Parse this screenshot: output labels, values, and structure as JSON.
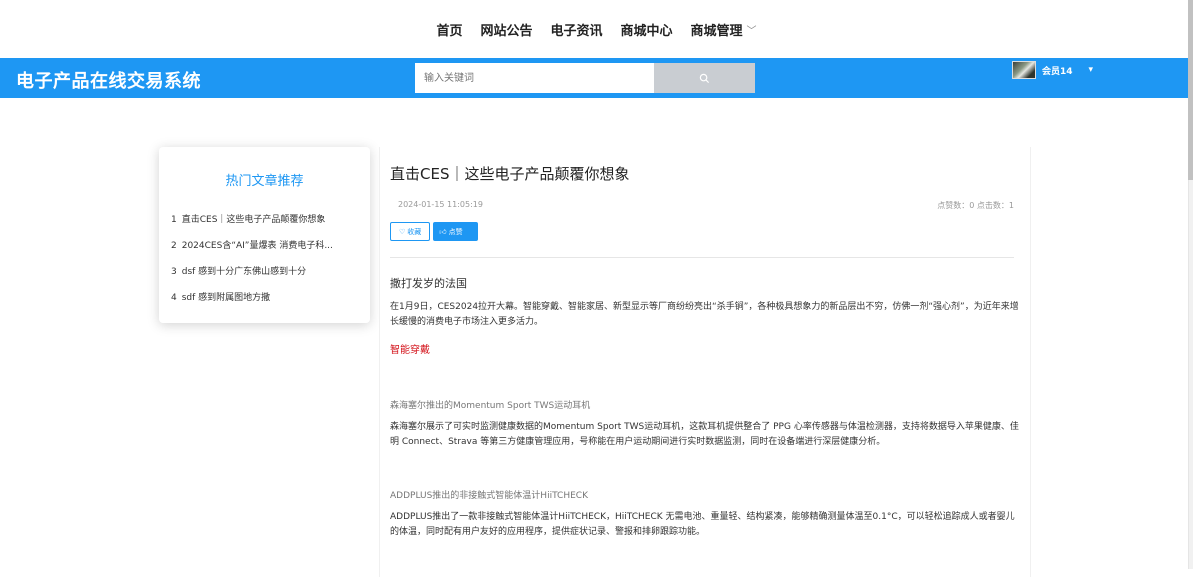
{
  "nav": {
    "items": [
      "首页",
      "网站公告",
      "电子资讯",
      "商城中心",
      "商城管理"
    ]
  },
  "header": {
    "brand": "电子产品在线交易系统",
    "search_placeholder": "输入关键词",
    "username": "会员14"
  },
  "hot": {
    "title": "热门文章推荐",
    "items": [
      {
        "num": "1",
        "text": "直击CES｜这些电子产品颠覆你想象"
      },
      {
        "num": "2",
        "text": "2024CES含“AI”量爆表 消费电子科..."
      },
      {
        "num": "3",
        "text": "dsf 感到十分广东佛山感到十分"
      },
      {
        "num": "4",
        "text": "sdf 感到附属图地方撒"
      }
    ]
  },
  "article": {
    "title": "直击CES｜这些电子产品颠覆你想象",
    "date": "2024-01-15 11:05:19",
    "stats": "点赞数：0   点击数：1",
    "fav_label": "收藏",
    "like_label": "点赞",
    "sub_heading": "撒打发岁的法国",
    "para1": "在1月9日，CES2024拉开大幕。智能穿戴、智能家居、新型显示等厂商纷纷亮出“杀手锏”，各种极具想象力的新品层出不穷，仿佛一剂“强心剂”，为近年来增长缓慢的消费电子市场注入更多活力。",
    "red_link": "智能穿戴",
    "section1_title": "森海塞尔推出的Momentum Sport TWS运动耳机",
    "section1_text": "森海塞尔展示了可实时监测健康数据的Momentum Sport TWS运动耳机，这款耳机提供整合了 PPG 心率传感器与体温检测器，支持将数据导入苹果健康、佳明 Connect、Strava 等第三方健康管理应用，号称能在用户运动期间进行实时数据监测，同时在设备端进行深层健康分析。",
    "section2_title": "ADDPLUS推出的非接触式智能体温计HiiTCHECK",
    "section2_text": "ADDPLUS推出了一款非接触式智能体温计HiiTCHECK，HiiTCHECK 无需电池、重量轻、结构紧凑，能够精确测量体温至0.1°C，可以轻松追踪成人或者婴儿的体温，同时配有用户友好的应用程序，提供症状记录、警报和排卵跟踪功能。"
  },
  "colors": {
    "accent": "#1e97f3",
    "link_red": "#d4141c"
  }
}
